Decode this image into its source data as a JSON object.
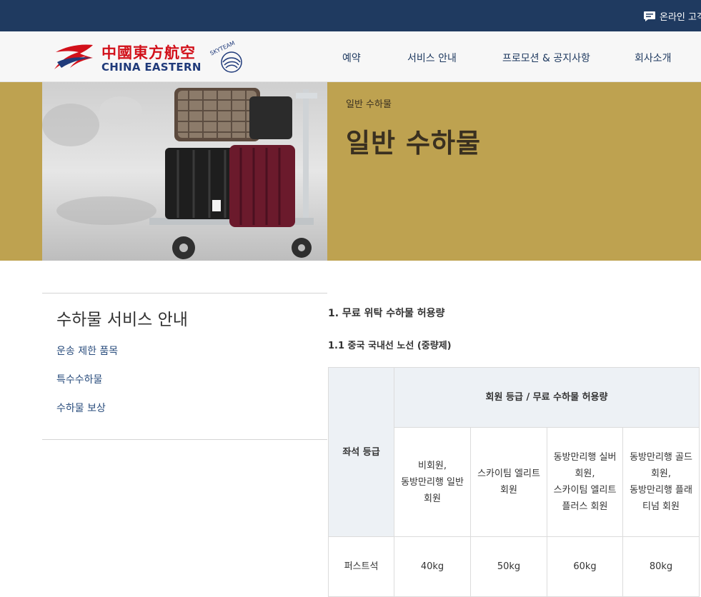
{
  "topbar": {
    "online_label": "온라인 고객"
  },
  "brand": {
    "name_cn": "中國東方航空",
    "name_en": "CHINA EASTERN",
    "alliance": "SKYTEAM",
    "colors": {
      "red": "#d2101a",
      "navy": "#1f3a7a"
    }
  },
  "nav": [
    "예약",
    "서비스 안내",
    "프로모션 & 공지사항",
    "회사소개"
  ],
  "hero": {
    "breadcrumb": "일반 수하물",
    "title": "일반 수하물",
    "image": "luggage-cart-photo"
  },
  "sidebar": {
    "title": "수하물 서비스 안내",
    "links": [
      "운송 제한 품목",
      "특수수하물",
      "수하물 보상"
    ]
  },
  "content": {
    "heading1": "1. 무료 위탁 수하물 허용량",
    "heading2": "1.1 중국 국내선 노선 (중량제)",
    "table": {
      "seat_header": "좌석 등급",
      "group_header": "회원 등급 / 무료 수하물 허용량",
      "member_headers": [
        [
          "비회원,",
          "동방만리행 일반",
          "회원"
        ],
        [
          "스카이팀 엘리트",
          "회원"
        ],
        [
          "동방만리행 실버",
          "회원,",
          "스카이팀 엘리트",
          "플러스 회원"
        ],
        [
          "동방만리행 골드",
          "회원,",
          "동방만리행 플래",
          "티넘 회원"
        ]
      ],
      "rows": [
        {
          "seat": "퍼스트석",
          "values": [
            "40kg",
            "50kg",
            "60kg",
            "80kg"
          ]
        }
      ]
    }
  }
}
